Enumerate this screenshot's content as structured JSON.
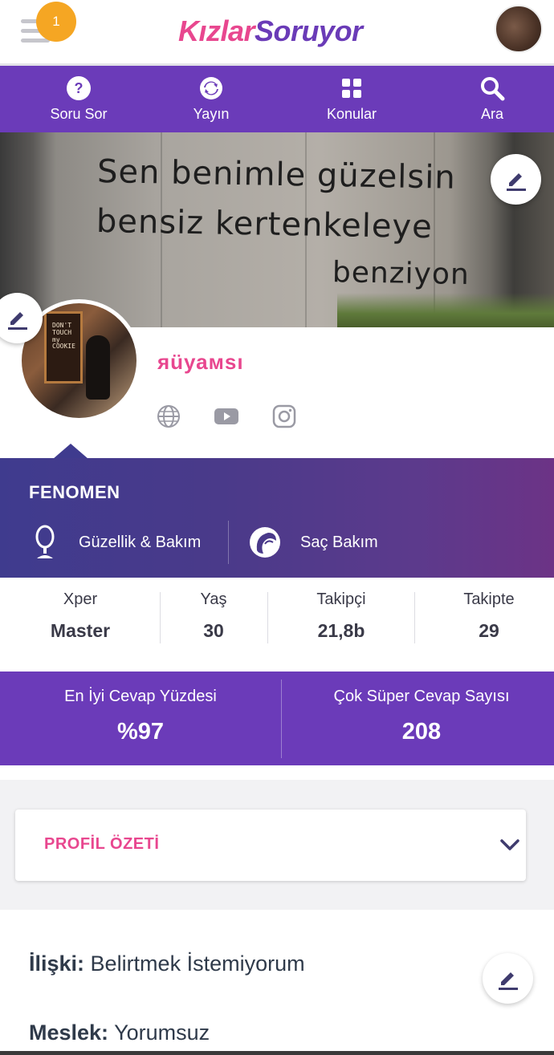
{
  "header": {
    "logo_part1": "Kızlar",
    "logo_part2": "Soruyor",
    "notification_count": "1",
    "icons": {
      "menu": "hamburger-icon",
      "avatar": "user-avatar"
    }
  },
  "nav": {
    "items": [
      {
        "label": "Soru Sor",
        "icon": "question-circle-icon"
      },
      {
        "label": "Yayın",
        "icon": "refresh-icon"
      },
      {
        "label": "Konular",
        "icon": "grid-icon"
      },
      {
        "label": "Ara",
        "icon": "search-icon"
      }
    ]
  },
  "cover": {
    "graffiti_lines": [
      "Sen benimle güzelsin",
      "bensiz kertenkeleye",
      "benziyon"
    ]
  },
  "avatar": {
    "door_text": "DON'T\nTOUCH\nmy\nCOOKIE"
  },
  "profile": {
    "username": "яüуамsı",
    "social_icons": [
      "globe-icon",
      "youtube-icon",
      "instagram-icon"
    ]
  },
  "fenomen": {
    "title": "FENOMEN",
    "categories": [
      {
        "label": "Güzellik & Bakım",
        "icon": "mirror-icon"
      },
      {
        "label": "Saç Bakım",
        "icon": "hair-icon"
      }
    ]
  },
  "stats": [
    {
      "label": "Xper",
      "value": "Master"
    },
    {
      "label": "Yaş",
      "value": "30"
    },
    {
      "label": "Takipçi",
      "value": "21,8b"
    },
    {
      "label": "Takipte",
      "value": "29"
    }
  ],
  "answers": [
    {
      "label": "En İyi Cevap Yüzdesi",
      "value": "%97"
    },
    {
      "label": "Çok Süper Cevap Sayısı",
      "value": "208"
    }
  ],
  "summary": {
    "title": "PROFİL ÖZETİ"
  },
  "info": {
    "relationship_label": "İlişki:",
    "relationship_value": "Belirtmek İstemiyorum",
    "job_label": "Meslek:",
    "job_value": "Yorumsuz"
  },
  "colors": {
    "brand_purple": "#6b3bb9",
    "brand_pink": "#e8478f",
    "badge_orange": "#f5a623"
  }
}
